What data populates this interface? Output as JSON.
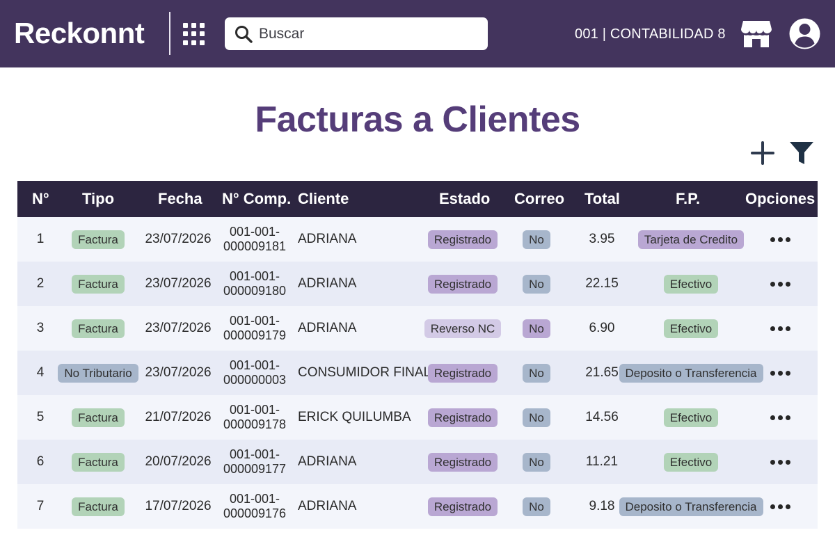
{
  "app": {
    "logo": "Reckonnt",
    "search_placeholder": "Buscar",
    "company": "001 | CONTABILIDAD 8"
  },
  "icons": {
    "apps": "apps-grid-icon",
    "search": "search-icon",
    "store": "store-icon",
    "user": "user-icon",
    "add": "plus-icon",
    "filter": "filter-icon",
    "options": "more-horizontal-icon"
  },
  "colors": {
    "topbar": "#43345d",
    "title": "#553d79",
    "table_header": "#2c2540",
    "pill_green": "#b2d3b8",
    "pill_blue": "#a7b6cb",
    "pill_purple": "#b9a7d3",
    "pill_lavender": "#d3cae6"
  },
  "page": {
    "title": "Facturas a Clientes"
  },
  "table": {
    "headers": {
      "num": "N°",
      "tipo": "Tipo",
      "fecha": "Fecha",
      "comp": "N° Comp.",
      "cliente": "Cliente",
      "estado": "Estado",
      "correo": "Correo",
      "total": "Total",
      "fp": "F.P.",
      "opciones": "Opciones"
    },
    "rows": [
      {
        "num": "1",
        "tipo": "Factura",
        "fecha": "23/07/2026",
        "comp1": "001-001-",
        "comp2": "000009181",
        "cliente": "ADRIANA",
        "estado": "Registrado",
        "correo": "No",
        "total": "3.95",
        "fp": "Tarjeta de Credito"
      },
      {
        "num": "2",
        "tipo": "Factura",
        "fecha": "23/07/2026",
        "comp1": "001-001-",
        "comp2": "000009180",
        "cliente": "ADRIANA",
        "estado": "Registrado",
        "correo": "No",
        "total": "22.15",
        "fp": "Efectivo"
      },
      {
        "num": "3",
        "tipo": "Factura",
        "fecha": "23/07/2026",
        "comp1": "001-001-",
        "comp2": "000009179",
        "cliente": "ADRIANA",
        "estado": "Reverso NC",
        "correo": "No",
        "total": "6.90",
        "fp": "Efectivo"
      },
      {
        "num": "4",
        "tipo": "No Tributario",
        "fecha": "23/07/2026",
        "comp1": "001-001-",
        "comp2": "000000003",
        "cliente": "CONSUMIDOR FINAL",
        "estado": "Registrado",
        "correo": "No",
        "total": "21.65",
        "fp": "Deposito o Transferencia"
      },
      {
        "num": "5",
        "tipo": "Factura",
        "fecha": "21/07/2026",
        "comp1": "001-001-",
        "comp2": "000009178",
        "cliente": "ERICK QUILUMBA",
        "estado": "Registrado",
        "correo": "No",
        "total": "14.56",
        "fp": "Efectivo"
      },
      {
        "num": "6",
        "tipo": "Factura",
        "fecha": "20/07/2026",
        "comp1": "001-001-",
        "comp2": "000009177",
        "cliente": "ADRIANA",
        "estado": "Registrado",
        "correo": "No",
        "total": "11.21",
        "fp": "Efectivo"
      },
      {
        "num": "7",
        "tipo": "Factura",
        "fecha": "17/07/2026",
        "comp1": "001-001-",
        "comp2": "000009176",
        "cliente": "ADRIANA",
        "estado": "Registrado",
        "correo": "No",
        "total": "9.18",
        "fp": "Deposito o Transferencia"
      }
    ]
  }
}
